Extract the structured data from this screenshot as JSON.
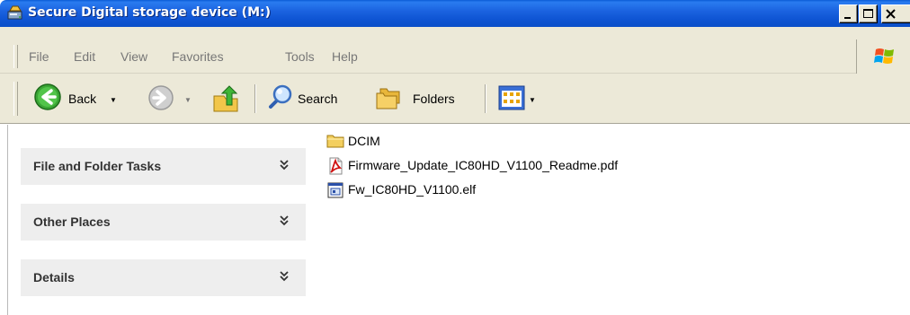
{
  "window": {
    "title": "Secure Digital storage device (M:)"
  },
  "menu": {
    "items": [
      "File",
      "Edit",
      "View",
      "Favorites",
      "Tools",
      "Help"
    ]
  },
  "toolbar": {
    "back_label": "Back",
    "search_label": "Search",
    "folders_label": "Folders"
  },
  "tasks": {
    "panels": [
      {
        "title": "File and Folder Tasks"
      },
      {
        "title": "Other Places"
      },
      {
        "title": "Details"
      }
    ]
  },
  "files": [
    {
      "name": "DCIM",
      "icon": "folder-icon"
    },
    {
      "name": "Firmware_Update_IC80HD_V1100_Readme.pdf",
      "icon": "pdf-file-icon"
    },
    {
      "name": "Fw_IC80HD_V1100.elf",
      "icon": "elf-file-icon"
    }
  ],
  "colors": {
    "titlebar": "#0f55d4",
    "chrome": "#ece9d8",
    "panel": "#eeeeee"
  }
}
